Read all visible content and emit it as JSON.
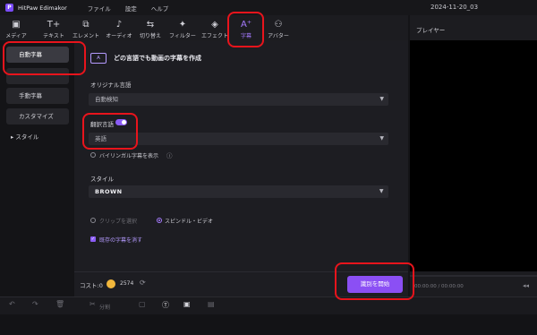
{
  "app": {
    "name": "HitPaw Edimakor",
    "logo_letter": "P"
  },
  "menu": [
    "ファイル",
    "設定",
    "ヘルプ"
  ],
  "project_date": "2024-11-20_03",
  "toolbar": {
    "tools": [
      {
        "label": "メディア",
        "icon": "media-icon",
        "glyph": "▣"
      },
      {
        "label": "テキスト",
        "icon": "text-icon",
        "glyph": "T+"
      },
      {
        "label": "エレメント",
        "icon": "element-icon",
        "glyph": "⧉"
      },
      {
        "label": "オーディオ",
        "icon": "audio-icon",
        "glyph": "♪"
      },
      {
        "label": "切り替え",
        "icon": "transition-icon",
        "glyph": "⇆"
      },
      {
        "label": "フィルター",
        "icon": "filter-icon",
        "glyph": "✦"
      },
      {
        "label": "エフェクト",
        "icon": "effect-icon",
        "glyph": "◈"
      },
      {
        "label": "字幕",
        "icon": "subtitle-icon",
        "glyph": "A⁺",
        "active": true
      },
      {
        "label": "アバター",
        "icon": "avatar-icon",
        "glyph": "⚇"
      }
    ]
  },
  "player": {
    "title": "プレイヤー",
    "time": "00:00:00 / 00:00:00"
  },
  "sidebar": {
    "items": [
      {
        "label": "自動字幕",
        "active": true
      },
      {
        "label": ""
      },
      {
        "label": "手動字幕"
      },
      {
        "label": "カスタマイズ"
      }
    ],
    "style_label": "スタイル",
    "style_arrow": "▸"
  },
  "panel": {
    "icon_text": "A",
    "heading": "どの言語でも動画の字幕を作成",
    "original_language_label": "オリジナル言語",
    "original_language_value": "自動検知",
    "translate_label": "翻訳言語",
    "translate_enabled": true,
    "translate_value": "英語",
    "bilingual_label": "バイリンガル字幕を表示",
    "style_label": "スタイル",
    "style_value": "BROWN",
    "option_clip": "クリップを選択",
    "option_spindle": "スピンドル・ビデオ",
    "clear_existing_label": "既存の字幕を消す"
  },
  "cost": {
    "label": "コスト:0",
    "value": "2574"
  },
  "start_button": "識別を開始",
  "timeline": {
    "split_label": "分割"
  },
  "colors": {
    "accent": "#8b5cf6",
    "annotation": "#e8141c",
    "coin": "#f2b73c"
  }
}
